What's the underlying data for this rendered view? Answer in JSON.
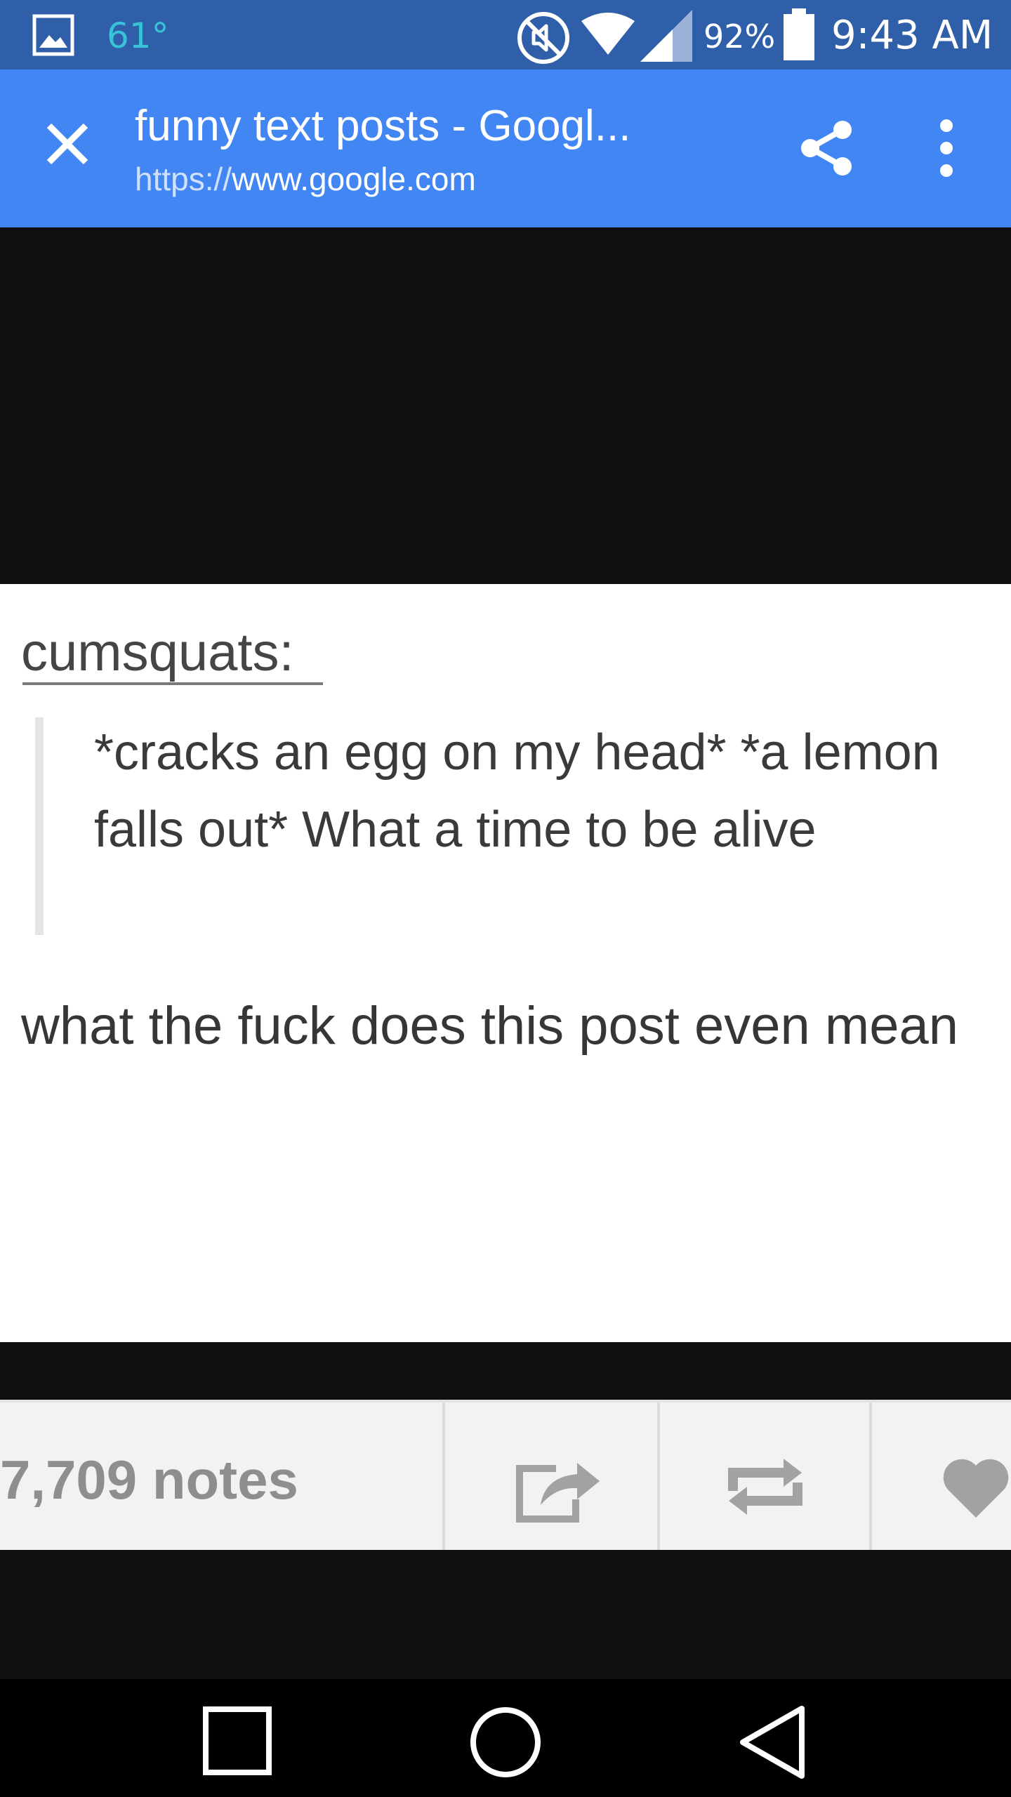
{
  "status_bar": {
    "temperature": "61°",
    "battery": "92%",
    "time": "9:43 AM",
    "icons": [
      "gallery-icon",
      "mute-icon",
      "wifi-icon",
      "signal-icon",
      "battery-icon"
    ]
  },
  "toolbar": {
    "title": "funny text posts - Googl...",
    "url_scheme": "https://",
    "url_host": "www.google.com",
    "icons": [
      "close-icon",
      "share-icon",
      "more-vert-icon"
    ]
  },
  "post": {
    "username": "cumsquats:",
    "quote": "*cracks an egg on my head* *a lemon falls out* What a time to be alive",
    "reply": "what the fuck does this post even mean",
    "notes": "7,709 notes",
    "icons": [
      "share-icon",
      "reblog-icon",
      "heart-icon"
    ]
  },
  "nav_bar": {
    "icons": [
      "recents-icon",
      "home-icon",
      "back-icon"
    ]
  },
  "colors": {
    "status_bar": "#2f5fa8",
    "toolbar": "#4286f4",
    "content_bg": "#0f0f0f",
    "temperature_text": "#38c3d8"
  }
}
